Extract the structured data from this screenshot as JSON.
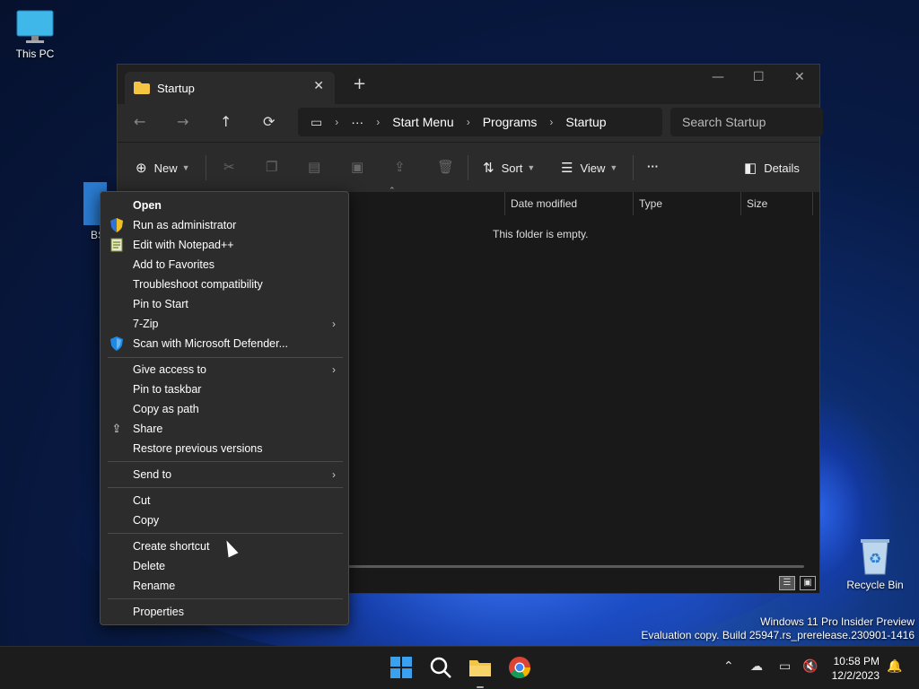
{
  "desktop": {
    "icons": [
      {
        "label": "This PC"
      },
      {
        "label": "Recycle Bin"
      },
      {
        "label": "BS"
      }
    ],
    "watermark_line1": "Windows 11 Pro Insider Preview",
    "watermark_line2": "Evaluation copy. Build 25947.rs_prerelease.230901-1416"
  },
  "explorer": {
    "tab_title": "Startup",
    "breadcrumb": [
      "Start Menu",
      "Programs",
      "Startup"
    ],
    "breadcrumb_more": "···",
    "search_placeholder": "Search Startup",
    "toolbar": {
      "new_label": "New",
      "sort_label": "Sort",
      "view_label": "View",
      "more_label": "···",
      "details_label": "Details"
    },
    "columns": [
      "Date modified",
      "Type",
      "Size"
    ],
    "empty_message": "This folder is empty."
  },
  "context_menu": {
    "items": [
      {
        "label": "Open"
      },
      {
        "label": "Run as administrator"
      },
      {
        "label": "Edit with Notepad++"
      },
      {
        "label": "Add to Favorites"
      },
      {
        "label": "Troubleshoot compatibility"
      },
      {
        "label": "Pin to Start"
      },
      {
        "label": "7-Zip"
      },
      {
        "label": "Scan with Microsoft Defender..."
      },
      {
        "label": "Give access to"
      },
      {
        "label": "Pin to taskbar"
      },
      {
        "label": "Copy as path"
      },
      {
        "label": "Share"
      },
      {
        "label": "Restore previous versions"
      },
      {
        "label": "Send to"
      },
      {
        "label": "Cut"
      },
      {
        "label": "Copy"
      },
      {
        "label": "Create shortcut"
      },
      {
        "label": "Delete"
      },
      {
        "label": "Rename"
      },
      {
        "label": "Properties"
      }
    ]
  },
  "taskbar": {
    "time": "10:58 PM",
    "date": "12/2/2023"
  },
  "colors": {
    "accent": "#0078d4",
    "menu_bg": "#2c2c2c",
    "window_bg": "#191919"
  }
}
